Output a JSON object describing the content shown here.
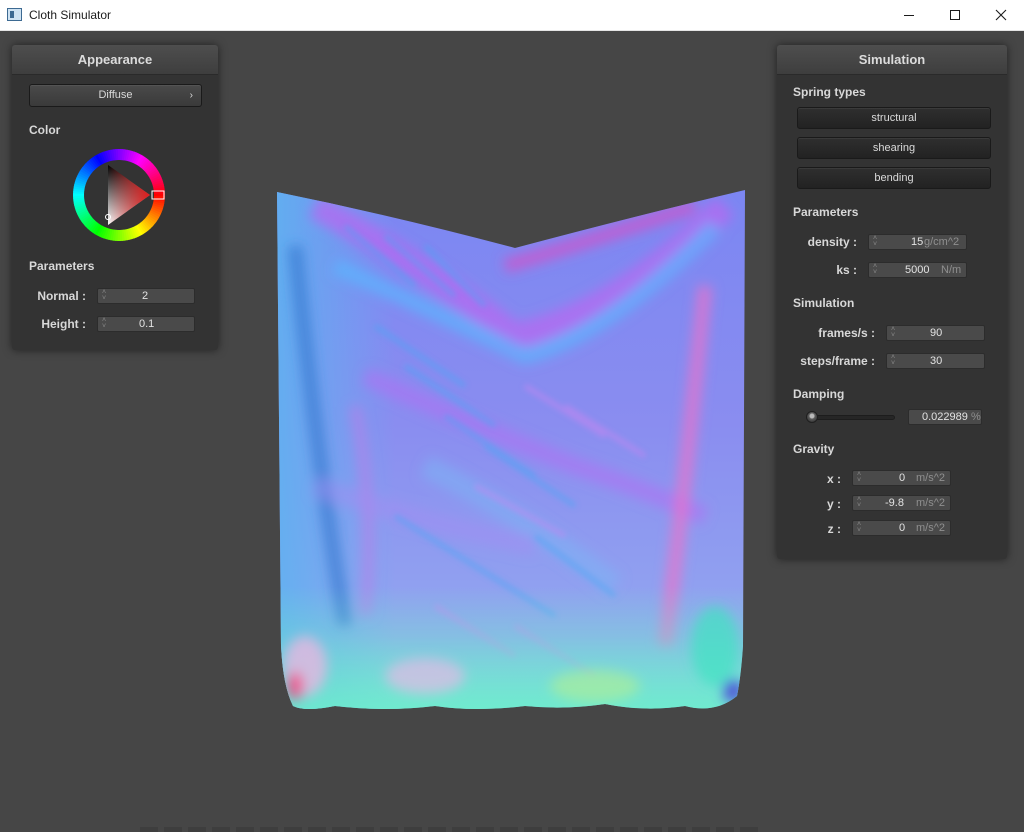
{
  "window": {
    "title": "Cloth Simulator",
    "minimize_icon": "minimize-icon",
    "maximize_icon": "maximize-icon",
    "close_icon": "close-icon"
  },
  "appearance": {
    "title": "Appearance",
    "shader": "Diffuse",
    "color_label": "Color",
    "color_value": "#e01c1c",
    "parameters_label": "Parameters",
    "normal_label": "Normal :",
    "normal_value": "2",
    "height_label": "Height :",
    "height_value": "0.1"
  },
  "simulation": {
    "title": "Simulation",
    "spring_types_label": "Spring types",
    "spring_buttons": [
      "structural",
      "shearing",
      "bending"
    ],
    "parameters_label": "Parameters",
    "density_label": "density :",
    "density_value": "15",
    "density_unit": "g/cm^2",
    "ks_label": "ks :",
    "ks_value": "5000",
    "ks_unit": "N/m",
    "simulation_label": "Simulation",
    "fps_label": "frames/s :",
    "fps_value": "90",
    "steps_label": "steps/frame :",
    "steps_value": "30",
    "damping_label": "Damping",
    "damping_fraction": 0.022989,
    "damping_value": "0.022989",
    "damping_unit": "%",
    "gravity_label": "Gravity",
    "gx_label": "x :",
    "gx_value": "0",
    "gy_label": "y :",
    "gy_value": "-9.8",
    "gz_label": "z :",
    "gz_value": "0",
    "gravity_unit": "m/s^2"
  }
}
